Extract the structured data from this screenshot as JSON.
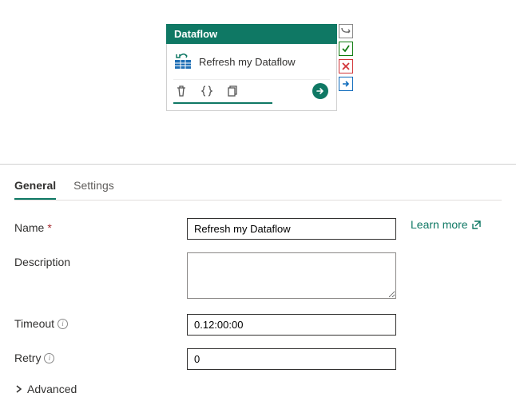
{
  "activity": {
    "type_label": "Dataflow",
    "name": "Refresh my Dataflow"
  },
  "tabs": {
    "general": "General",
    "settings": "Settings"
  },
  "form": {
    "name_label": "Name",
    "name_value": "Refresh my Dataflow",
    "description_label": "Description",
    "description_value": "",
    "timeout_label": "Timeout",
    "timeout_value": "0.12:00:00",
    "retry_label": "Retry",
    "retry_value": "0",
    "advanced_label": "Advanced"
  },
  "links": {
    "learn_more": "Learn more"
  }
}
